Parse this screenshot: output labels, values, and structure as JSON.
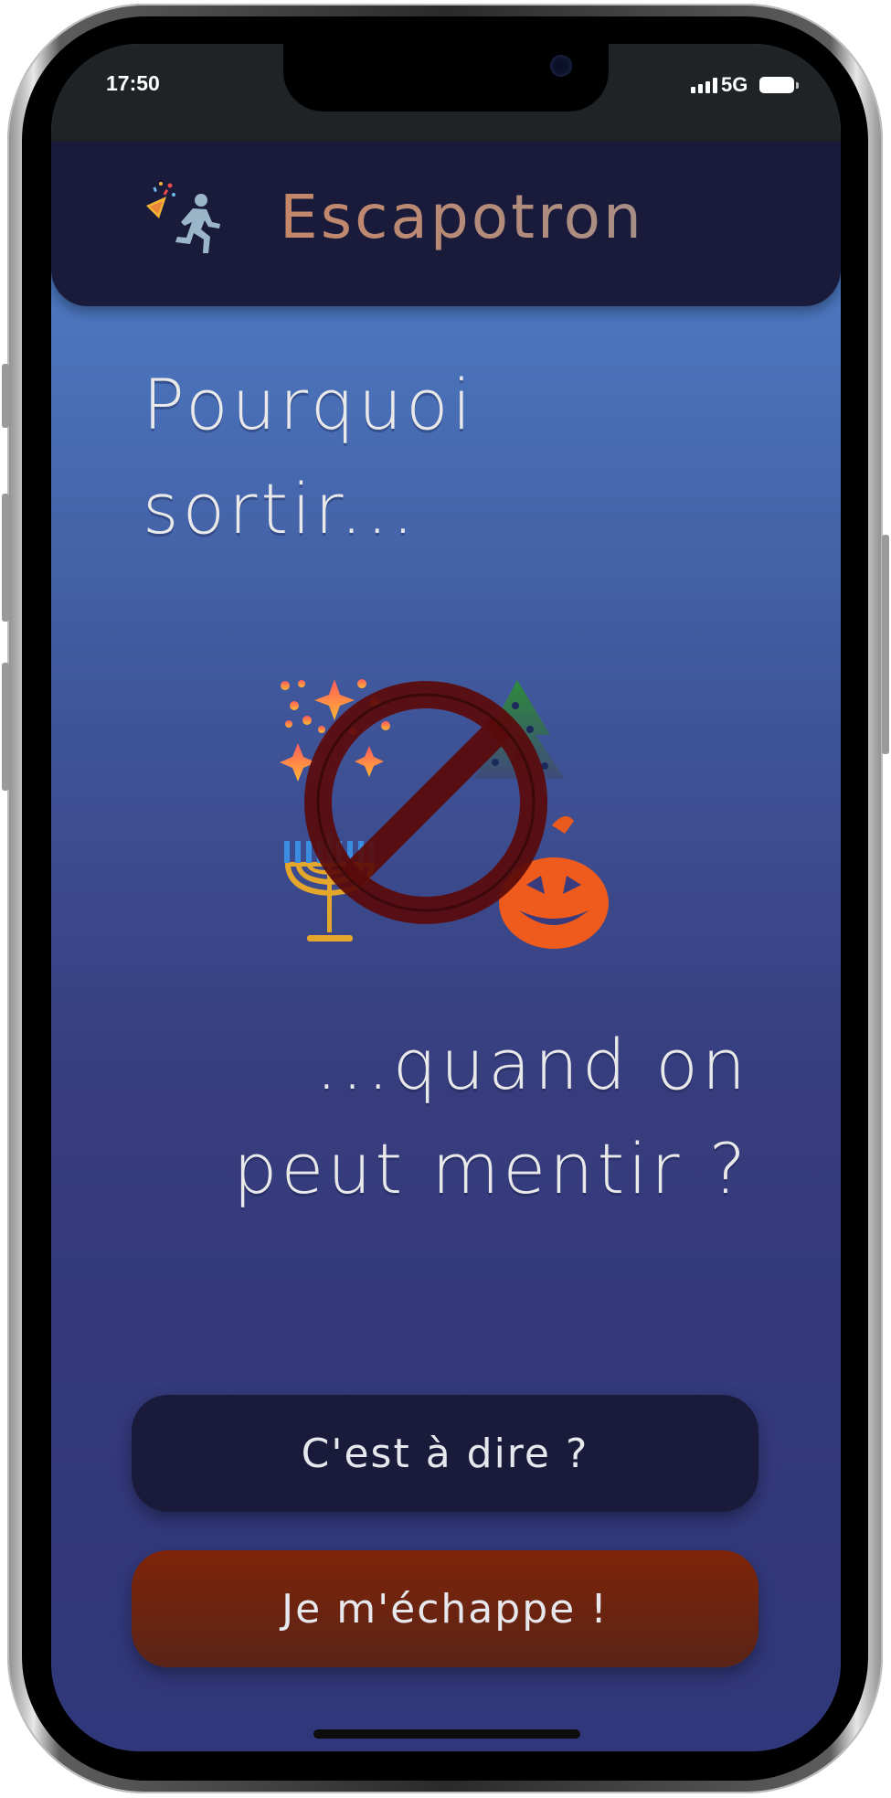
{
  "status_bar": {
    "time": "17:50",
    "network": "5G"
  },
  "header": {
    "title": "Escapotron",
    "logo_icons": [
      "party-popper-icon",
      "running-person-icon"
    ]
  },
  "main": {
    "headline_top": "Pourquoi sortir...",
    "headline_bottom": "...quand on peut mentir ?",
    "illustration_icons": [
      "fireworks-icon",
      "christmas-tree-icon",
      "menorah-icon",
      "jack-o-lantern-icon",
      "prohibited-icon"
    ]
  },
  "buttons": {
    "info_label": "C'est à dire ?",
    "escape_label": "Je m'échappe !"
  },
  "colors": {
    "header_bg": "#1a1b3b",
    "title_gradient_start": "#c58769",
    "escape_button": "#7e2408",
    "background_top": "#4c7fc3",
    "background_bottom": "#30377a"
  }
}
